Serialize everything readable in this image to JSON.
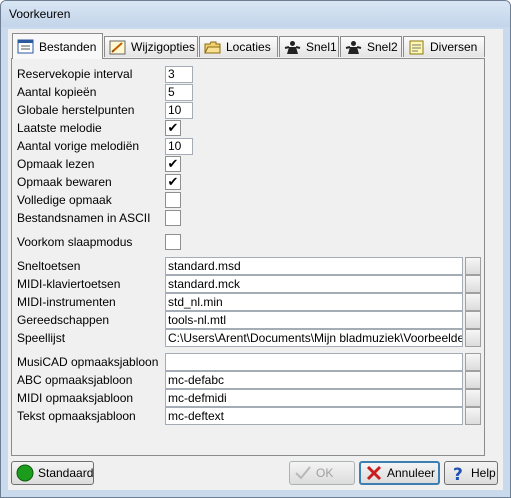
{
  "window": {
    "title": "Voorkeuren"
  },
  "tabs": [
    {
      "label": "Bestanden",
      "icon": "file-list-icon"
    },
    {
      "label": "Wijzigopties",
      "icon": "edit-pencil-icon"
    },
    {
      "label": "Locaties",
      "icon": "folder-icon"
    },
    {
      "label": "Snel1",
      "icon": "keyboard-shortcut-icon"
    },
    {
      "label": "Snel2",
      "icon": "keyboard-shortcut-icon"
    },
    {
      "label": "Diversen",
      "icon": "notes-icon"
    }
  ],
  "fields": {
    "backup_interval": {
      "label": "Reservekopie interval",
      "value": "3"
    },
    "num_copies": {
      "label": "Aantal kopieën",
      "value": "5"
    },
    "restore_points": {
      "label": "Globale herstelpunten",
      "value": "10"
    },
    "last_melody": {
      "label": "Laatste melodie",
      "checked": "✔"
    },
    "prev_melodies": {
      "label": "Aantal vorige melodiën",
      "value": "10"
    },
    "read_layout": {
      "label": "Opmaak lezen",
      "checked": "✔"
    },
    "save_layout": {
      "label": "Opmaak bewaren",
      "checked": "✔"
    },
    "full_layout": {
      "label": "Volledige opmaak",
      "checked": ""
    },
    "ascii_names": {
      "label": "Bestandsnamen in ASCII",
      "checked": ""
    },
    "prevent_sleep": {
      "label": "Voorkom slaapmodus",
      "checked": ""
    }
  },
  "files": [
    {
      "label": "Sneltoetsen",
      "value": "standard.msd"
    },
    {
      "label": "MIDI-klaviertoetsen",
      "value": "standard.mck"
    },
    {
      "label": "MIDI-instrumenten",
      "value": "std_nl.min"
    },
    {
      "label": "Gereedschappen",
      "value": "tools-nl.mtl"
    },
    {
      "label": "Speellijst",
      "value": "C:\\Users\\Arent\\Documents\\Mijn bladmuziek\\Voorbeelden\\intro"
    }
  ],
  "templates": [
    {
      "label": "MusiCAD opmaaksjabloon",
      "value": ""
    },
    {
      "label": "ABC opmaaksjabloon",
      "value": "mc-defabc"
    },
    {
      "label": "MIDI opmaaksjabloon",
      "value": "mc-defmidi"
    },
    {
      "label": "Tekst opmaaksjabloon",
      "value": "mc-deftext"
    }
  ],
  "buttons": {
    "standard": "Standaard",
    "ok": "OK",
    "cancel": "Annuleer",
    "help": "Help"
  },
  "colors": {
    "accent": "#3c7fb1",
    "standard_icon": "#1c9c1c",
    "cancel_icon": "#c81e1e",
    "help_icon": "#1e4fb4"
  }
}
